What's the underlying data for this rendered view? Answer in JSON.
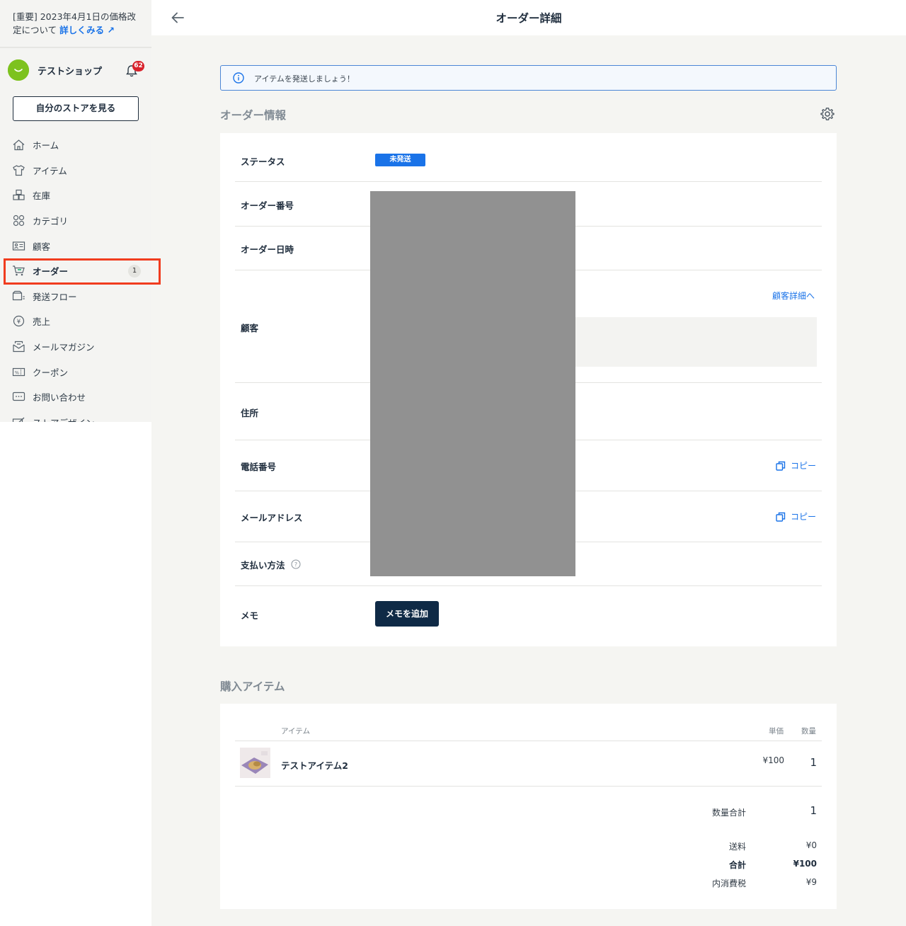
{
  "notice": {
    "text": "[重要] 2023年4月1日の価格改定について",
    "link": "詳しくみる ↗"
  },
  "shop": {
    "name": "テストショップ",
    "notification_count": "62"
  },
  "sidebar": {
    "store_button": "自分のストアを見る",
    "items": [
      {
        "label": "ホーム",
        "icon": "home-icon"
      },
      {
        "label": "アイテム",
        "icon": "shirt-icon"
      },
      {
        "label": "在庫",
        "icon": "boxes-icon"
      },
      {
        "label": "カテゴリ",
        "icon": "grid-icon"
      },
      {
        "label": "顧客",
        "icon": "id-card-icon"
      },
      {
        "label": "オーダー",
        "icon": "cart-icon",
        "count": "1"
      },
      {
        "label": "発送フロー",
        "icon": "shipping-icon"
      },
      {
        "label": "売上",
        "icon": "yen-icon"
      },
      {
        "label": "メールマガジン",
        "icon": "mail-icon"
      },
      {
        "label": "クーポン",
        "icon": "coupon-icon"
      },
      {
        "label": "お問い合わせ",
        "icon": "chat-icon"
      },
      {
        "label": "ストアデザイン",
        "icon": "design-icon"
      }
    ]
  },
  "header": {
    "title": "オーダー詳細"
  },
  "banner": {
    "text": "アイテムを発送しましょう！"
  },
  "order_info": {
    "section_title": "オーダー情報",
    "status_label": "ステータス",
    "status_value": "未発送",
    "order_number_label": "オーダー番号",
    "order_date_label": "オーダー日時",
    "customer_label": "顧客",
    "customer_link": "顧客詳細へ",
    "address_label": "住所",
    "phone_label": "電話番号",
    "email_label": "メールアドレス",
    "payment_label": "支払い方法",
    "memo_label": "メモ",
    "copy_label": "コピー",
    "memo_button": "メモを追加"
  },
  "items": {
    "section_title": "購入アイテム",
    "col_item": "アイテム",
    "col_price": "単価",
    "col_qty": "数量",
    "rows": [
      {
        "name": "テストアイテム2",
        "price": "¥100",
        "qty": "1"
      }
    ],
    "qty_total_label": "数量合計",
    "qty_total": "1",
    "shipping_label": "送料",
    "shipping": "¥0",
    "total_label": "合計",
    "total": "¥100",
    "tax_label": "内消費税",
    "tax": "¥9"
  },
  "colors": {
    "accent": "#1a73e8",
    "navy": "#0f2a46",
    "highlight": "#f03c1f",
    "badge": "#d8222b",
    "avatar": "#7dc21e"
  }
}
